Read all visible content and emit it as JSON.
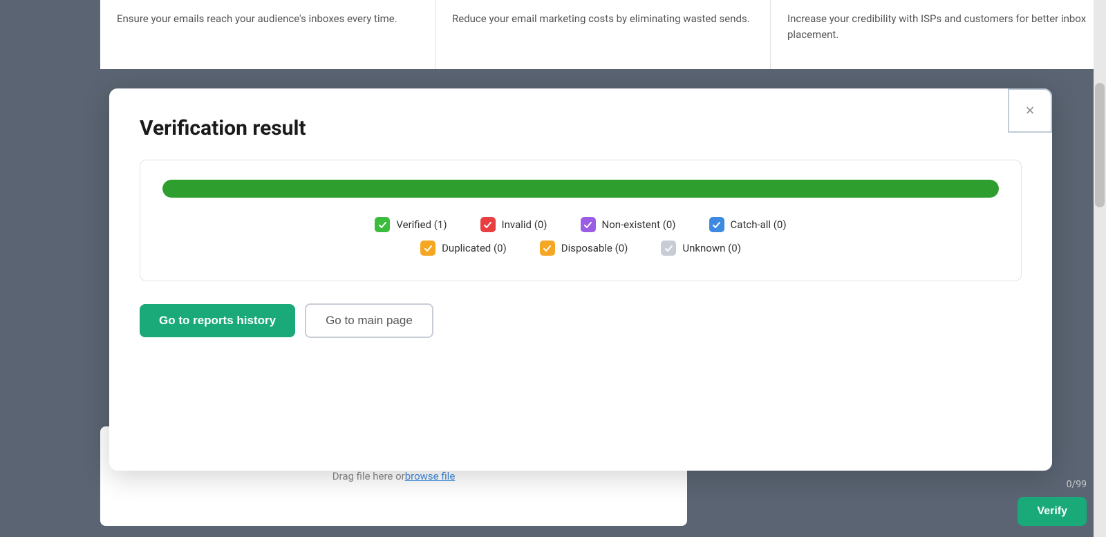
{
  "background": {
    "top_cards": [
      {
        "text": "Ensure your emails reach your audience's inboxes every time."
      },
      {
        "text": "Reduce your email marketing costs by eliminating wasted sends."
      },
      {
        "text": "Increase your credibility with ISPs and customers for better inbox placement."
      }
    ]
  },
  "modal": {
    "title": "Verification result",
    "close_label": "×",
    "progress_percent": 100,
    "progress_color": "#2e9e2e",
    "legend_row1": [
      {
        "label": "Verified (1)",
        "color_class": "icon-green"
      },
      {
        "label": "Invalid (0)",
        "color_class": "icon-red"
      },
      {
        "label": "Non-existent (0)",
        "color_class": "icon-purple"
      },
      {
        "label": "Catch-all (0)",
        "color_class": "icon-blue"
      }
    ],
    "legend_row2": [
      {
        "label": "Duplicated (0)",
        "color_class": "icon-orange"
      },
      {
        "label": "Disposable (0)",
        "color_class": "icon-orange2"
      },
      {
        "label": "Unknown (0)",
        "color_class": "icon-gray"
      }
    ],
    "btn_primary_label": "Go to reports history",
    "btn_secondary_label": "Go to main page"
  },
  "bottom": {
    "drag_text": "Drag file here or ",
    "browse_text": "browse file",
    "count_text": "0/99",
    "verify_label": "Verify"
  }
}
